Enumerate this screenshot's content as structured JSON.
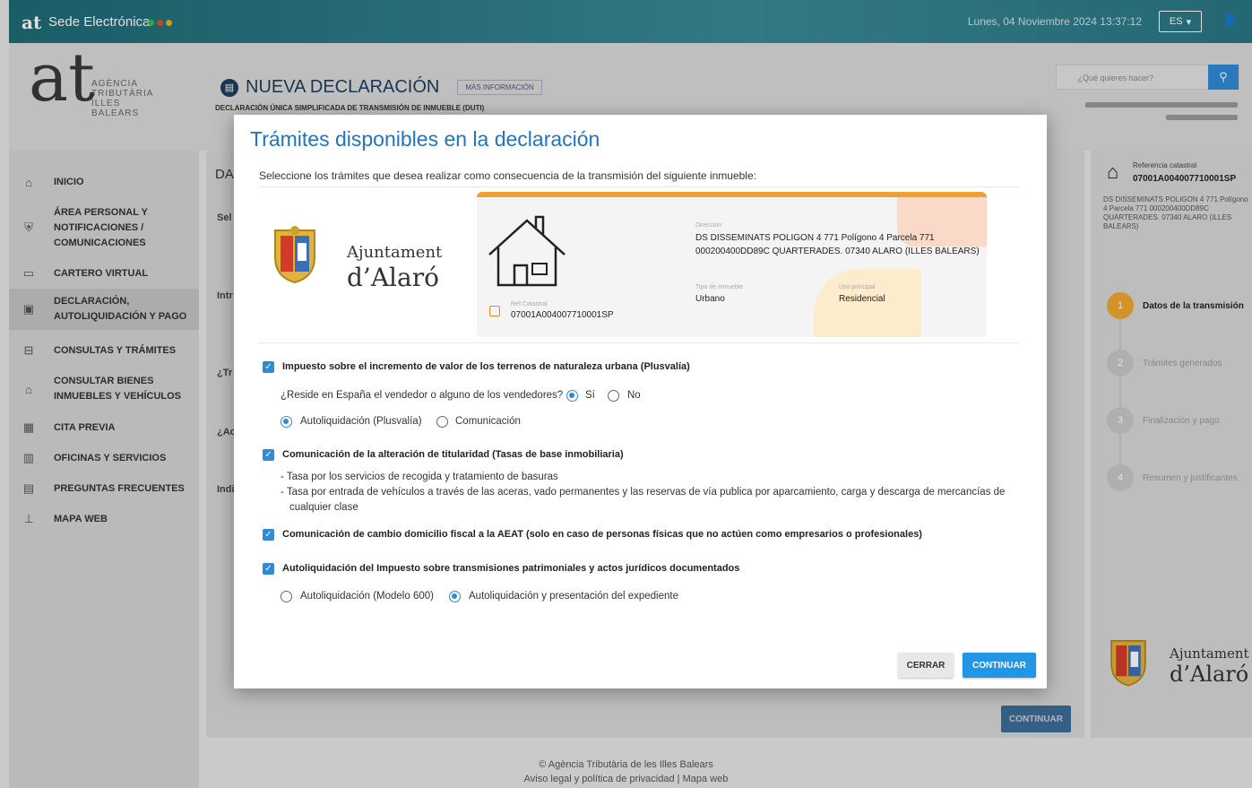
{
  "topbar": {
    "logo": "at",
    "title": "Sede Electrónica",
    "datetime": "Lunes, 04 Noviembre 2024 13:37:12",
    "lang": "ES",
    "dot_colors": [
      "#2fbf4f",
      "#e84a2a",
      "#f0b020"
    ]
  },
  "header": {
    "agency_logo_letter": "at",
    "agency_lines": [
      "AGÈNCIA",
      "TRIBUTÀRIA",
      "ILLES BALEARS"
    ],
    "page_title": "NUEVA DECLARACIÓN",
    "mas_info": "MÁS INFORMACIÓN",
    "subtitle": "DECLARACIÓN ÚNICA SIMPLIFICADA DE TRANSMISIÓN DE INMUEBLE (DUTI)",
    "search_placeholder": "¿Qué quieres hacer?"
  },
  "sidebar": {
    "items": [
      {
        "label": "INICIO",
        "icon": "home-icon"
      },
      {
        "label": "ÁREA PERSONAL Y NOTIFICACIONES / COMUNICACIONES",
        "icon": "shield-icon"
      },
      {
        "label": "CARTERO VIRTUAL",
        "icon": "monitor-icon"
      },
      {
        "label": "DECLARACIÓN, AUTOLIQUIDACIÓN Y PAGO",
        "icon": "document-icon"
      },
      {
        "label": "CONSULTAS Y TRÁMITES",
        "icon": "briefcase-icon"
      },
      {
        "label": "CONSULTAR BIENES INMUEBLES Y VEHÍCULOS",
        "icon": "building-icon"
      },
      {
        "label": "CITA PREVIA",
        "icon": "calendar-icon"
      },
      {
        "label": "OFICINAS Y SERVICIOS",
        "icon": "office-icon"
      },
      {
        "label": "PREGUNTAS FRECUENTES",
        "icon": "faq-icon"
      },
      {
        "label": "MAPA WEB",
        "icon": "sitemap-icon"
      }
    ]
  },
  "background": {
    "section_title": "DA",
    "labels": [
      "Sel",
      "Intr",
      "¿Tr",
      "¿Ac",
      "Indi"
    ],
    "continue": "CONTINUAR"
  },
  "right_panel": {
    "ref_label": "Referencia catastral",
    "ref_value": "07001A004007710001SP",
    "address": "DS DISSEMINATS POLIGON 4 771 Polígono 4 Parcela 771 000200400DD89C QUARTERADES. 07340 ALARO (ILLES BALEARS)",
    "steps": [
      {
        "num": "1",
        "label": "Datos de la transmisión"
      },
      {
        "num": "2",
        "label": "Trámites generados"
      },
      {
        "num": "3",
        "label": "Finalización y pago"
      },
      {
        "num": "4",
        "label": "Resumen y justificantes"
      }
    ]
  },
  "modal": {
    "title": "Trámites disponibles en la declaración",
    "intro": "Seleccione los trámites que desea realizar como consecuencia de la transmisión del siguiente inmueble:",
    "ayuntamiento": {
      "line1": "Ajuntament",
      "line2": "d’Alaró"
    },
    "property": {
      "direccion_label": "Direccion",
      "direccion": "DS DISSEMINATS POLIGON 4 771 Polígono 4 Parcela 771 000200400DD89C QUARTERADES. 07340 ALARO (ILLES BALEARS)",
      "tipo_label": "Tipo de inmueble",
      "tipo": "Urbano",
      "uso_label": "Uso principal",
      "uso": "Residencial",
      "ref_label": "Ref.Catastral",
      "ref": "07001A004007710001SP"
    },
    "items": [
      {
        "label": "Impuesto sobre el incremento de valor de los terrenos de naturaleza urbana (Plusvalía)",
        "checked": true
      },
      {
        "label": "Comunicación de la alteración de titularidad (Tasas de base inmobiliaria)",
        "checked": true
      },
      {
        "label": "Comunicación de cambio domicilio fiscal a la AEAT (solo en caso de personas físicas que no actúen como empresarios o profesionales)",
        "checked": true
      },
      {
        "label": "Autoliquidación del Impuesto sobre transmisiones patrimoniales y actos jurídicos documentados",
        "checked": true
      }
    ],
    "plusvalia": {
      "question": "¿Reside en España el vendedor o alguno de los vendedores?",
      "si": "Sí",
      "no": "No",
      "opt1": "Autoliquidación (Plusvalía)",
      "opt2": "Comunicación"
    },
    "tasas": {
      "line1": "- Tasa por los servicios de recogida y tratamiento de basuras",
      "line2": "- Tasa por entrada de vehículos a través de las aceras, vado permanentes y las reservas de vía publica por aparcamiento, carga y descarga de mercancías de",
      "line3": "cualquier clase"
    },
    "itp": {
      "opt1": "Autoliquidación (Modelo 600)",
      "opt2": "Autoliquidación y presentación del expediente"
    },
    "cerrar": "CERRAR",
    "continuar": "CONTINUAR"
  },
  "footer": {
    "line1": "© Agència Tributària de les Illes Balears",
    "legal": "Aviso legal y política de privacidad",
    "sep": "|",
    "mapa": "Mapa web"
  }
}
